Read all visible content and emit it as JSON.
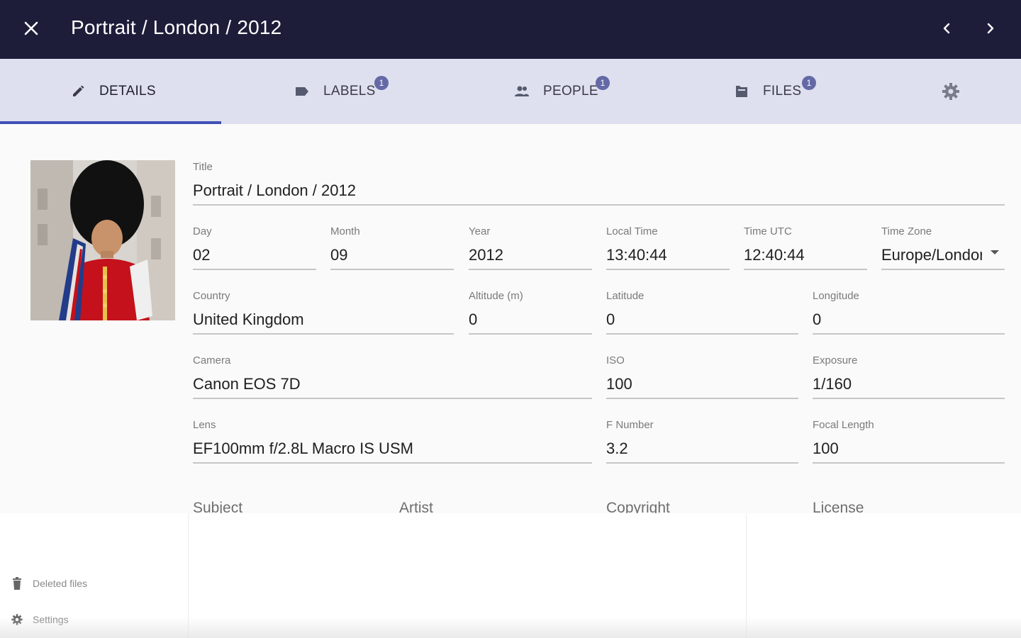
{
  "window": {
    "title": "Portrait / London / 2012",
    "icons": {
      "close": "close-icon",
      "prev": "chevron-left-icon",
      "next": "chevron-right-icon"
    }
  },
  "colors": {
    "topbar": "#1d1d3a",
    "tabbar": "#dfe0ef",
    "accent": "#3f51b5",
    "badge": "#6469a6"
  },
  "tabs": [
    {
      "label": "DETAILS",
      "icon": "pencil-icon",
      "active": true
    },
    {
      "label": "LABELS",
      "icon": "label-icon",
      "badge": "1"
    },
    {
      "label": "PEOPLE",
      "icon": "people-icon",
      "badge": "1"
    },
    {
      "label": "FILES",
      "icon": "folder-icon",
      "badge": "1"
    }
  ],
  "tab_settings_icon": "gear-icon",
  "photo": {
    "alt": "Portrait of a royal guard in bearskin hat and red tunic"
  },
  "form": {
    "title": {
      "label": "Title",
      "value": "Portrait / London / 2012"
    },
    "day": {
      "label": "Day",
      "value": "02"
    },
    "month": {
      "label": "Month",
      "value": "09"
    },
    "year": {
      "label": "Year",
      "value": "2012"
    },
    "local_time": {
      "label": "Local Time",
      "value": "13:40:44"
    },
    "time_utc": {
      "label": "Time UTC",
      "value": "12:40:44"
    },
    "time_zone": {
      "label": "Time Zone",
      "value": "Europe/Londor"
    },
    "country": {
      "label": "Country",
      "value": "United Kingdom"
    },
    "altitude": {
      "label": "Altitude (m)",
      "value": "0"
    },
    "latitude": {
      "label": "Latitude",
      "value": "0"
    },
    "longitude": {
      "label": "Longitude",
      "value": "0"
    },
    "camera": {
      "label": "Camera",
      "value": "Canon EOS 7D"
    },
    "iso": {
      "label": "ISO",
      "value": "100"
    },
    "exposure": {
      "label": "Exposure",
      "value": "1/160"
    },
    "lens": {
      "label": "Lens",
      "value": "EF100mm f/2.8L Macro IS USM"
    },
    "f_number": {
      "label": "F Number",
      "value": "3.2"
    },
    "focal_length": {
      "label": "Focal Length",
      "value": "100"
    },
    "subject": {
      "label": "Subject"
    },
    "artist": {
      "label": "Artist"
    },
    "copyright": {
      "label": "Copyright"
    },
    "license": {
      "label": "License"
    }
  },
  "sidebar": {
    "deleted_files": {
      "label": "Deleted files",
      "icon": "trash-icon"
    },
    "settings": {
      "label": "Settings",
      "icon": "gear-icon"
    }
  }
}
